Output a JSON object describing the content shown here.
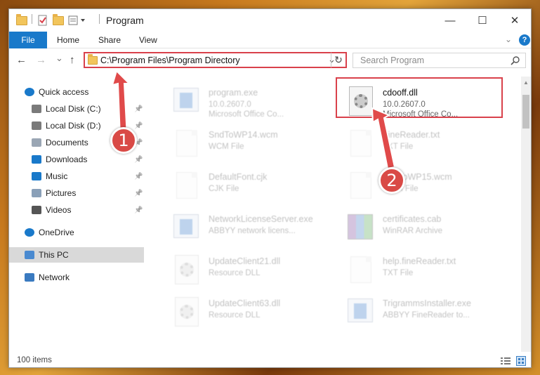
{
  "window": {
    "title": "Program",
    "minimize_glyph": "—",
    "maximize_glyph": "☐",
    "close_glyph": "✕"
  },
  "ribbon": {
    "file_tab": "File",
    "tabs": [
      "Home",
      "Share",
      "View"
    ]
  },
  "nav": {
    "back_glyph": "←",
    "forward_glyph": "→",
    "recent_glyph": "⌄",
    "up_glyph": "↑",
    "address": "C:\\Program Files\\Program Directory",
    "refresh_glyph": "↻",
    "search_placeholder": "Search Program"
  },
  "sidebar": {
    "items": [
      {
        "label": "Quick access",
        "icon": "star-icon",
        "pinned": false
      },
      {
        "label": "Local Disk (C:)",
        "icon": "drive-icon",
        "pinned": true
      },
      {
        "label": "Local Disk (D:)",
        "icon": "drive-icon",
        "pinned": true
      },
      {
        "label": "Documents",
        "icon": "documents-icon",
        "pinned": true
      },
      {
        "label": "Downloads",
        "icon": "download-icon",
        "pinned": true
      },
      {
        "label": "Music",
        "icon": "music-icon",
        "pinned": true
      },
      {
        "label": "Pictures",
        "icon": "pictures-icon",
        "pinned": true
      },
      {
        "label": "Videos",
        "icon": "videos-icon",
        "pinned": true
      },
      {
        "label": "OneDrive",
        "icon": "cloud-icon",
        "pinned": false
      },
      {
        "label": "This PC",
        "icon": "computer-icon",
        "pinned": false,
        "selected": true
      },
      {
        "label": "Network",
        "icon": "network-icon",
        "pinned": false
      }
    ]
  },
  "files": [
    {
      "name": "program.exe",
      "line2": "10.0.2607.0",
      "line3": "Microsoft Office Co...",
      "icon": "app-icon",
      "highlighted": false
    },
    {
      "name": "cdooff.dll",
      "line2": "10.0.2607.0",
      "line3": "Microsoft Office Co...",
      "icon": "gear-file-icon",
      "highlighted": true
    },
    {
      "name": "SndToWP14.wcm",
      "line2": "WCM File",
      "line3": "",
      "icon": "document-icon",
      "highlighted": false
    },
    {
      "name": "FineReader.txt",
      "line2": "TXT File",
      "line3": "",
      "icon": "document-icon",
      "highlighted": false
    },
    {
      "name": "DefaultFont.cjk",
      "line2": "CJK File",
      "line3": "",
      "icon": "document-icon",
      "highlighted": false
    },
    {
      "name": "SndToWP15.wcm",
      "line2": "WCM File",
      "line3": "",
      "icon": "document-icon",
      "highlighted": false
    },
    {
      "name": "NetworkLicenseServer.exe",
      "line2": "ABBYY network licens...",
      "line3": "",
      "icon": "app-icon",
      "highlighted": false
    },
    {
      "name": "certificates.cab",
      "line2": "WinRAR Archive",
      "line3": "",
      "icon": "archive-icon",
      "highlighted": false
    },
    {
      "name": "UpdateClient21.dll",
      "line2": "Resource DLL",
      "line3": "",
      "icon": "gear-file-icon",
      "highlighted": false
    },
    {
      "name": "help.fineReader.txt",
      "line2": "TXT File",
      "line3": "",
      "icon": "document-icon",
      "highlighted": false
    },
    {
      "name": "UpdateClient63.dll",
      "line2": "Resource DLL",
      "line3": "",
      "icon": "gear-file-icon",
      "highlighted": false
    },
    {
      "name": "TrigrammsInstaller.exe",
      "line2": "ABBYY FineReader to...",
      "line3": "",
      "icon": "app-icon",
      "highlighted": false
    }
  ],
  "annotations": {
    "step1": "1",
    "step2": "2",
    "highlight_color": "#d9414b"
  },
  "status": {
    "item_count": "100 items"
  }
}
